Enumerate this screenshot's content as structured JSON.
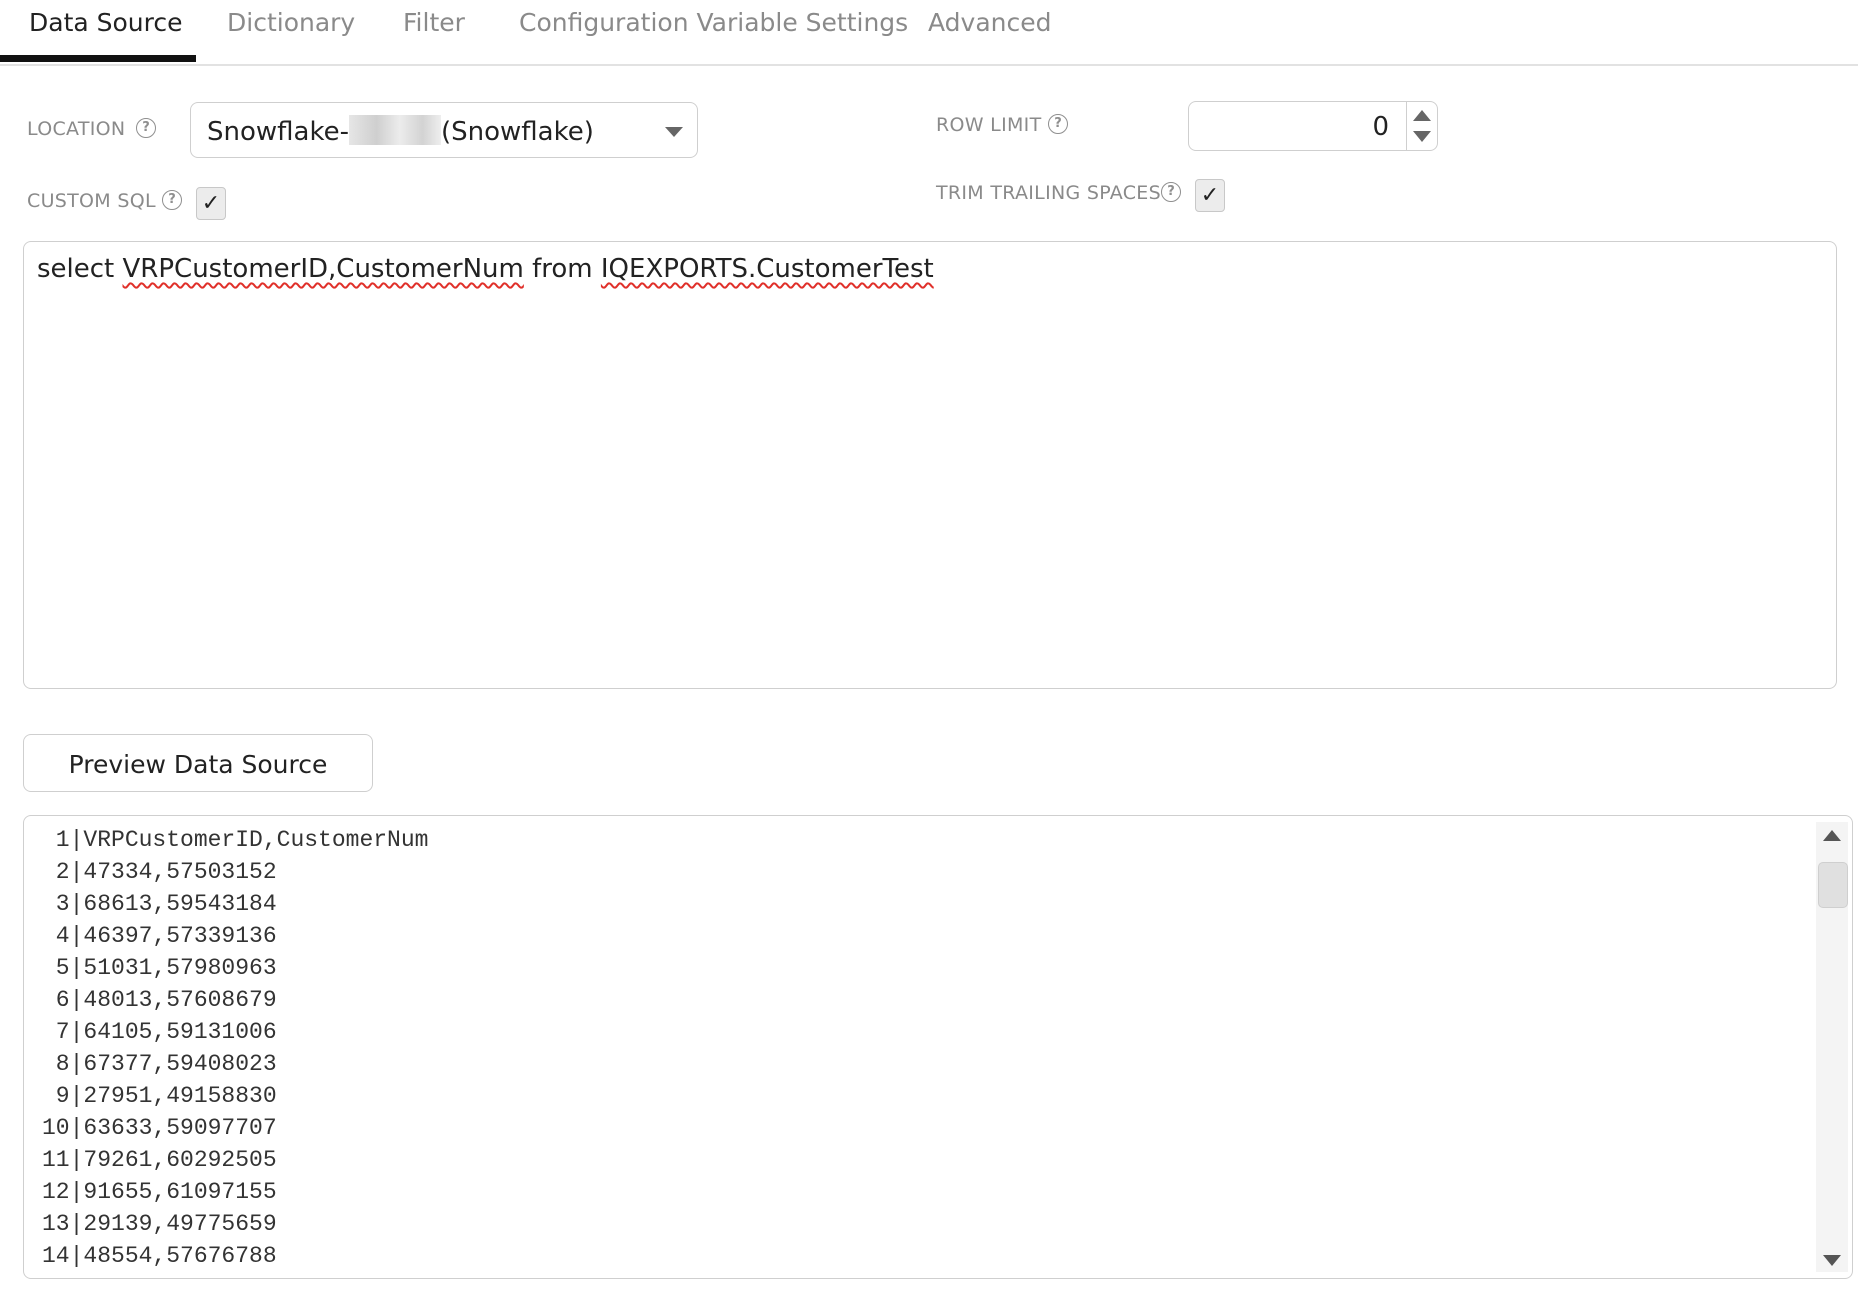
{
  "tabs": [
    {
      "label": "Data Source",
      "active": true
    },
    {
      "label": "Dictionary",
      "active": false
    },
    {
      "label": "Filter",
      "active": false
    },
    {
      "label": "Configuration Variable Settings",
      "active": false
    },
    {
      "label": "Advanced",
      "active": false
    }
  ],
  "location": {
    "label": "LOCATION",
    "value_prefix": "Snowflake-",
    "value_suffix": "(Snowflake)"
  },
  "row_limit": {
    "label": "ROW LIMIT",
    "value": "0"
  },
  "custom_sql": {
    "label": "CUSTOM SQL",
    "checked": true,
    "check_glyph": "✓"
  },
  "trim_trailing_spaces": {
    "label": "TRIM TRAILING SPACES",
    "checked": true,
    "check_glyph": "✓"
  },
  "help_glyph": "?",
  "sql": {
    "w1": "select ",
    "w2": "VRPCustomerID,CustomerNum",
    "w3": " from ",
    "w4": "IQEXPORTS.CustomerTest"
  },
  "preview_button": {
    "label": "Preview Data Source"
  },
  "output_lines": [
    " 1|VRPCustomerID,CustomerNum",
    " 2|47334,57503152",
    " 3|68613,59543184",
    " 4|46397,57339136",
    " 5|51031,57980963",
    " 6|48013,57608679",
    " 7|64105,59131006",
    " 8|67377,59408023",
    " 9|27951,49158830",
    "10|63633,59097707",
    "11|79261,60292505",
    "12|91655,61097155",
    "13|29139,49775659",
    "14|48554,57676788"
  ]
}
